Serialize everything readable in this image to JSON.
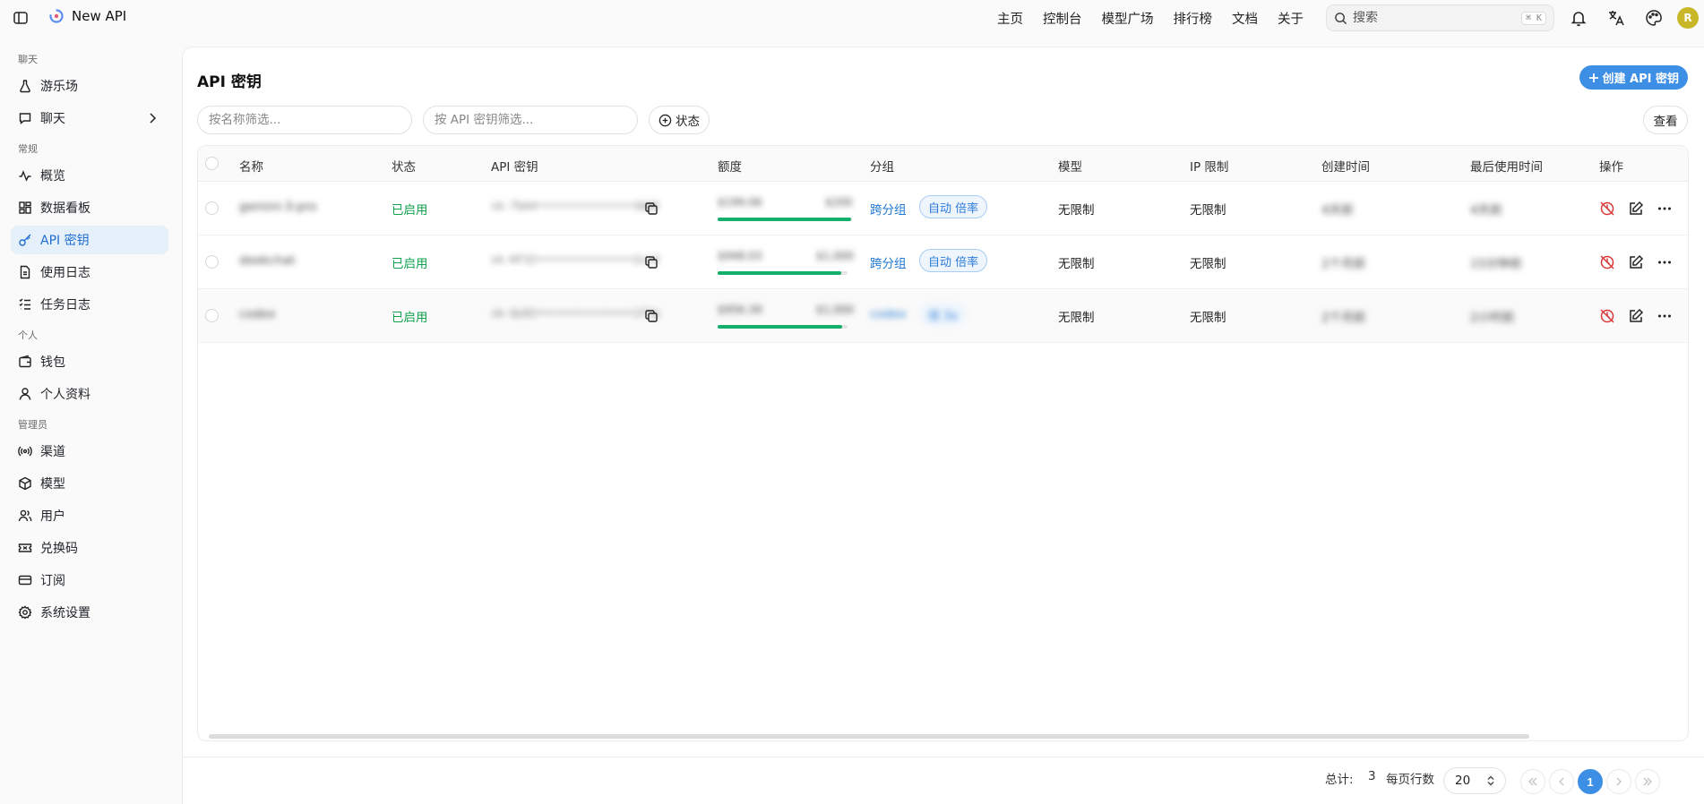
{
  "app": {
    "name": "New API"
  },
  "topnav": [
    "主页",
    "控制台",
    "模型广场",
    "排行榜",
    "文档",
    "关于"
  ],
  "search": {
    "placeholder": "搜索",
    "shortcut": "⌘ K"
  },
  "user": {
    "avatar_letter": "R",
    "avatar_color": "#c9b72a"
  },
  "sidebar": {
    "sections": [
      {
        "title": "聊天",
        "items": [
          {
            "label": "游乐场",
            "icon": "flask-icon"
          },
          {
            "label": "聊天",
            "icon": "chat-icon",
            "has_submenu": true
          }
        ]
      },
      {
        "title": "常规",
        "items": [
          {
            "label": "概览",
            "icon": "activity-icon"
          },
          {
            "label": "数据看板",
            "icon": "dashboard-icon"
          },
          {
            "label": "API 密钥",
            "icon": "key-icon",
            "active": true
          },
          {
            "label": "使用日志",
            "icon": "file-icon"
          },
          {
            "label": "任务日志",
            "icon": "list-check-icon"
          }
        ]
      },
      {
        "title": "个人",
        "items": [
          {
            "label": "钱包",
            "icon": "wallet-icon"
          },
          {
            "label": "个人资料",
            "icon": "user-icon"
          }
        ]
      },
      {
        "title": "管理员",
        "items": [
          {
            "label": "渠道",
            "icon": "radio-icon"
          },
          {
            "label": "模型",
            "icon": "cube-icon"
          },
          {
            "label": "用户",
            "icon": "users-icon"
          },
          {
            "label": "兑换码",
            "icon": "ticket-icon"
          },
          {
            "label": "订阅",
            "icon": "card-icon"
          },
          {
            "label": "系统设置",
            "icon": "gear-icon"
          }
        ]
      }
    ]
  },
  "main": {
    "title": "API 密钥",
    "create_button": "创建 API 密钥",
    "filter_name_placeholder": "按名称筛选...",
    "filter_key_placeholder": "按 API 密钥筛选...",
    "status_filter": "状态",
    "view_button": "查看",
    "columns": [
      "名称",
      "状态",
      "API 密钥",
      "额度",
      "分组",
      "模型",
      "IP 限制",
      "创建时间",
      "最后使用时间",
      "操作"
    ],
    "rows": [
      {
        "name": "gemini-3-pro",
        "status": "已启用",
        "key": "sk-7bA4•••••••••••••••3dd6",
        "quota_used": "$199.06",
        "quota_total": "$200",
        "quota_fraction": 0.99,
        "group": "跨分组",
        "group_tag": "自动 倍率",
        "group_tag_clear": true,
        "model": "无限制",
        "ip": "无限制",
        "created": "4天前",
        "last_used": "4天前"
      },
      {
        "name": "deekchat",
        "status": "已启用",
        "key": "sk-KF32•••••••••••••••2cn4",
        "quota_used": "$948.03",
        "quota_total": "$1,000",
        "quota_fraction": 0.95,
        "group": "跨分组",
        "group_tag": "自动 倍率",
        "group_tag_clear": true,
        "model": "无限制",
        "ip": "无限制",
        "created": "2个月前",
        "last_used": "15分钟前"
      },
      {
        "name": "codex",
        "status": "已启用",
        "key": "sk-Qu92•••••••••••••••1f7g",
        "quota_used": "$956.39",
        "quota_total": "$1,000",
        "quota_fraction": 0.96,
        "group": "codex",
        "group_tag": "倍 3x",
        "group_tag_clear": false,
        "model": "无限制",
        "ip": "无限制",
        "created": "2个月前",
        "last_used": "2小时前"
      }
    ]
  },
  "pagination": {
    "total_label": "总计:",
    "total": "3",
    "per_page_label": "每页行数",
    "per_page": "20",
    "current_page": "1"
  }
}
